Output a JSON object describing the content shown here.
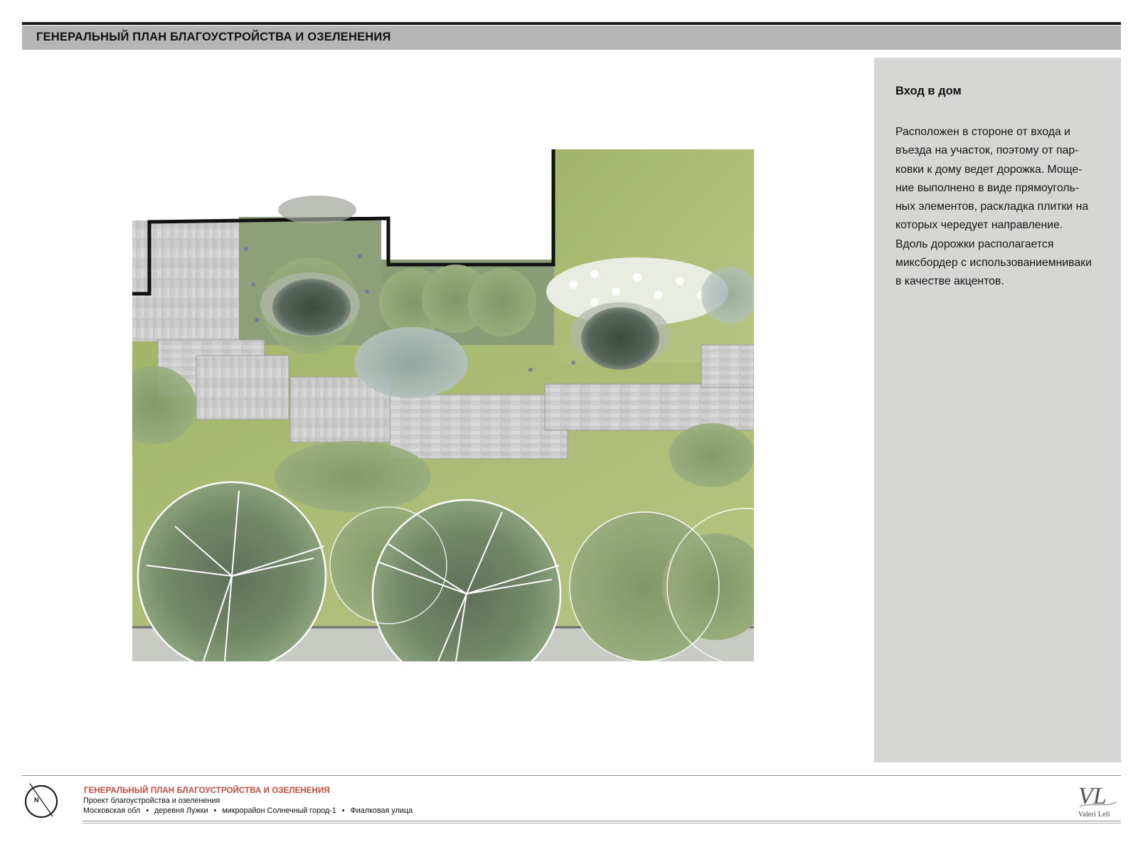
{
  "header": {
    "title": "ГЕНЕРАЛЬНЫЙ ПЛАН БЛАГОУСТРОЙСТВА И ОЗЕЛЕНЕНИЯ"
  },
  "side_panel": {
    "heading": "Вход в дом",
    "lines": [
      " Расположен в стороне от входа и",
      "въезда на участок, поэтому от пар-",
      "ковки к дому ведет дорожка. Моще-",
      "ние выполнено в виде прямоуголь-",
      "ных элементов, раскладка плитки на",
      "которых чередует направление.",
      " Вдоль дорожки располагается",
      "миксбордер с использованиемниваки",
      "в качестве акцентов."
    ]
  },
  "footer": {
    "title": "ГЕНЕРАЛЬНЫЙ ПЛАН БЛАГОУСТРОЙСТВА И ОЗЕЛЕНЕНИЯ",
    "subtitle": "Проект благоустройства и озеленения",
    "address": [
      "Московская обл",
      "деревня Лужки",
      "микрорайон Солнечный город-1",
      "Фиалковая улица"
    ],
    "address_separator": "•",
    "compass_label": "N",
    "logo_monogram": "VL",
    "logo_name": "Valeri Leli"
  },
  "colors": {
    "title_bar": "#b5b5b5",
    "side_panel": "#d6d6d5",
    "footer_accent": "#d24b3c",
    "lawn": "#a9bc74",
    "paving": "#c9c9c9",
    "shrub_dark": "#4d5a4f"
  }
}
